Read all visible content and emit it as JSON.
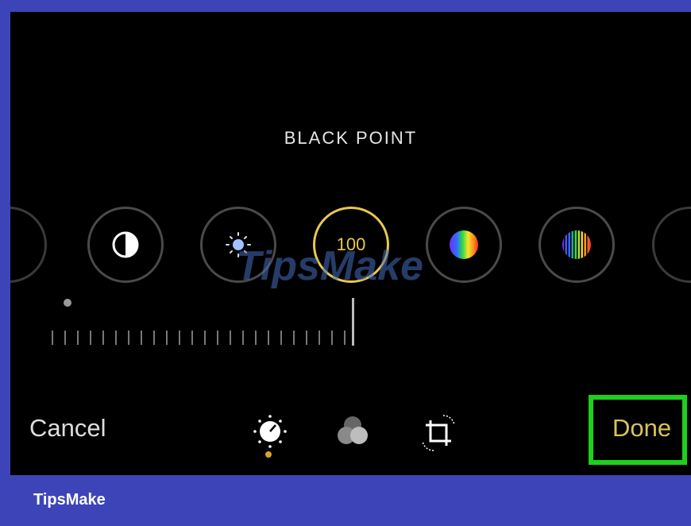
{
  "screen": {
    "header_title": "BLACK POINT",
    "selected_value": "100",
    "watermark": "TipsMake"
  },
  "adjustments": [
    {
      "name": "contrast-icon",
      "selected": false
    },
    {
      "name": "brightness-icon",
      "selected": false
    },
    {
      "name": "black-point",
      "selected": true
    },
    {
      "name": "saturation-icon",
      "selected": false
    },
    {
      "name": "vibrance-icon",
      "selected": false
    }
  ],
  "toolbar": {
    "cancel_label": "Cancel",
    "done_label": "Done",
    "tools": [
      "adjust-icon",
      "filters-icon",
      "crop-rotate-icon"
    ],
    "active_tool": "adjust-icon"
  },
  "footer": {
    "brand": "TipsMake"
  },
  "colors": {
    "accent": "#e8c84e",
    "highlight_box": "#1ed01e",
    "frame": "#3d44b8"
  }
}
